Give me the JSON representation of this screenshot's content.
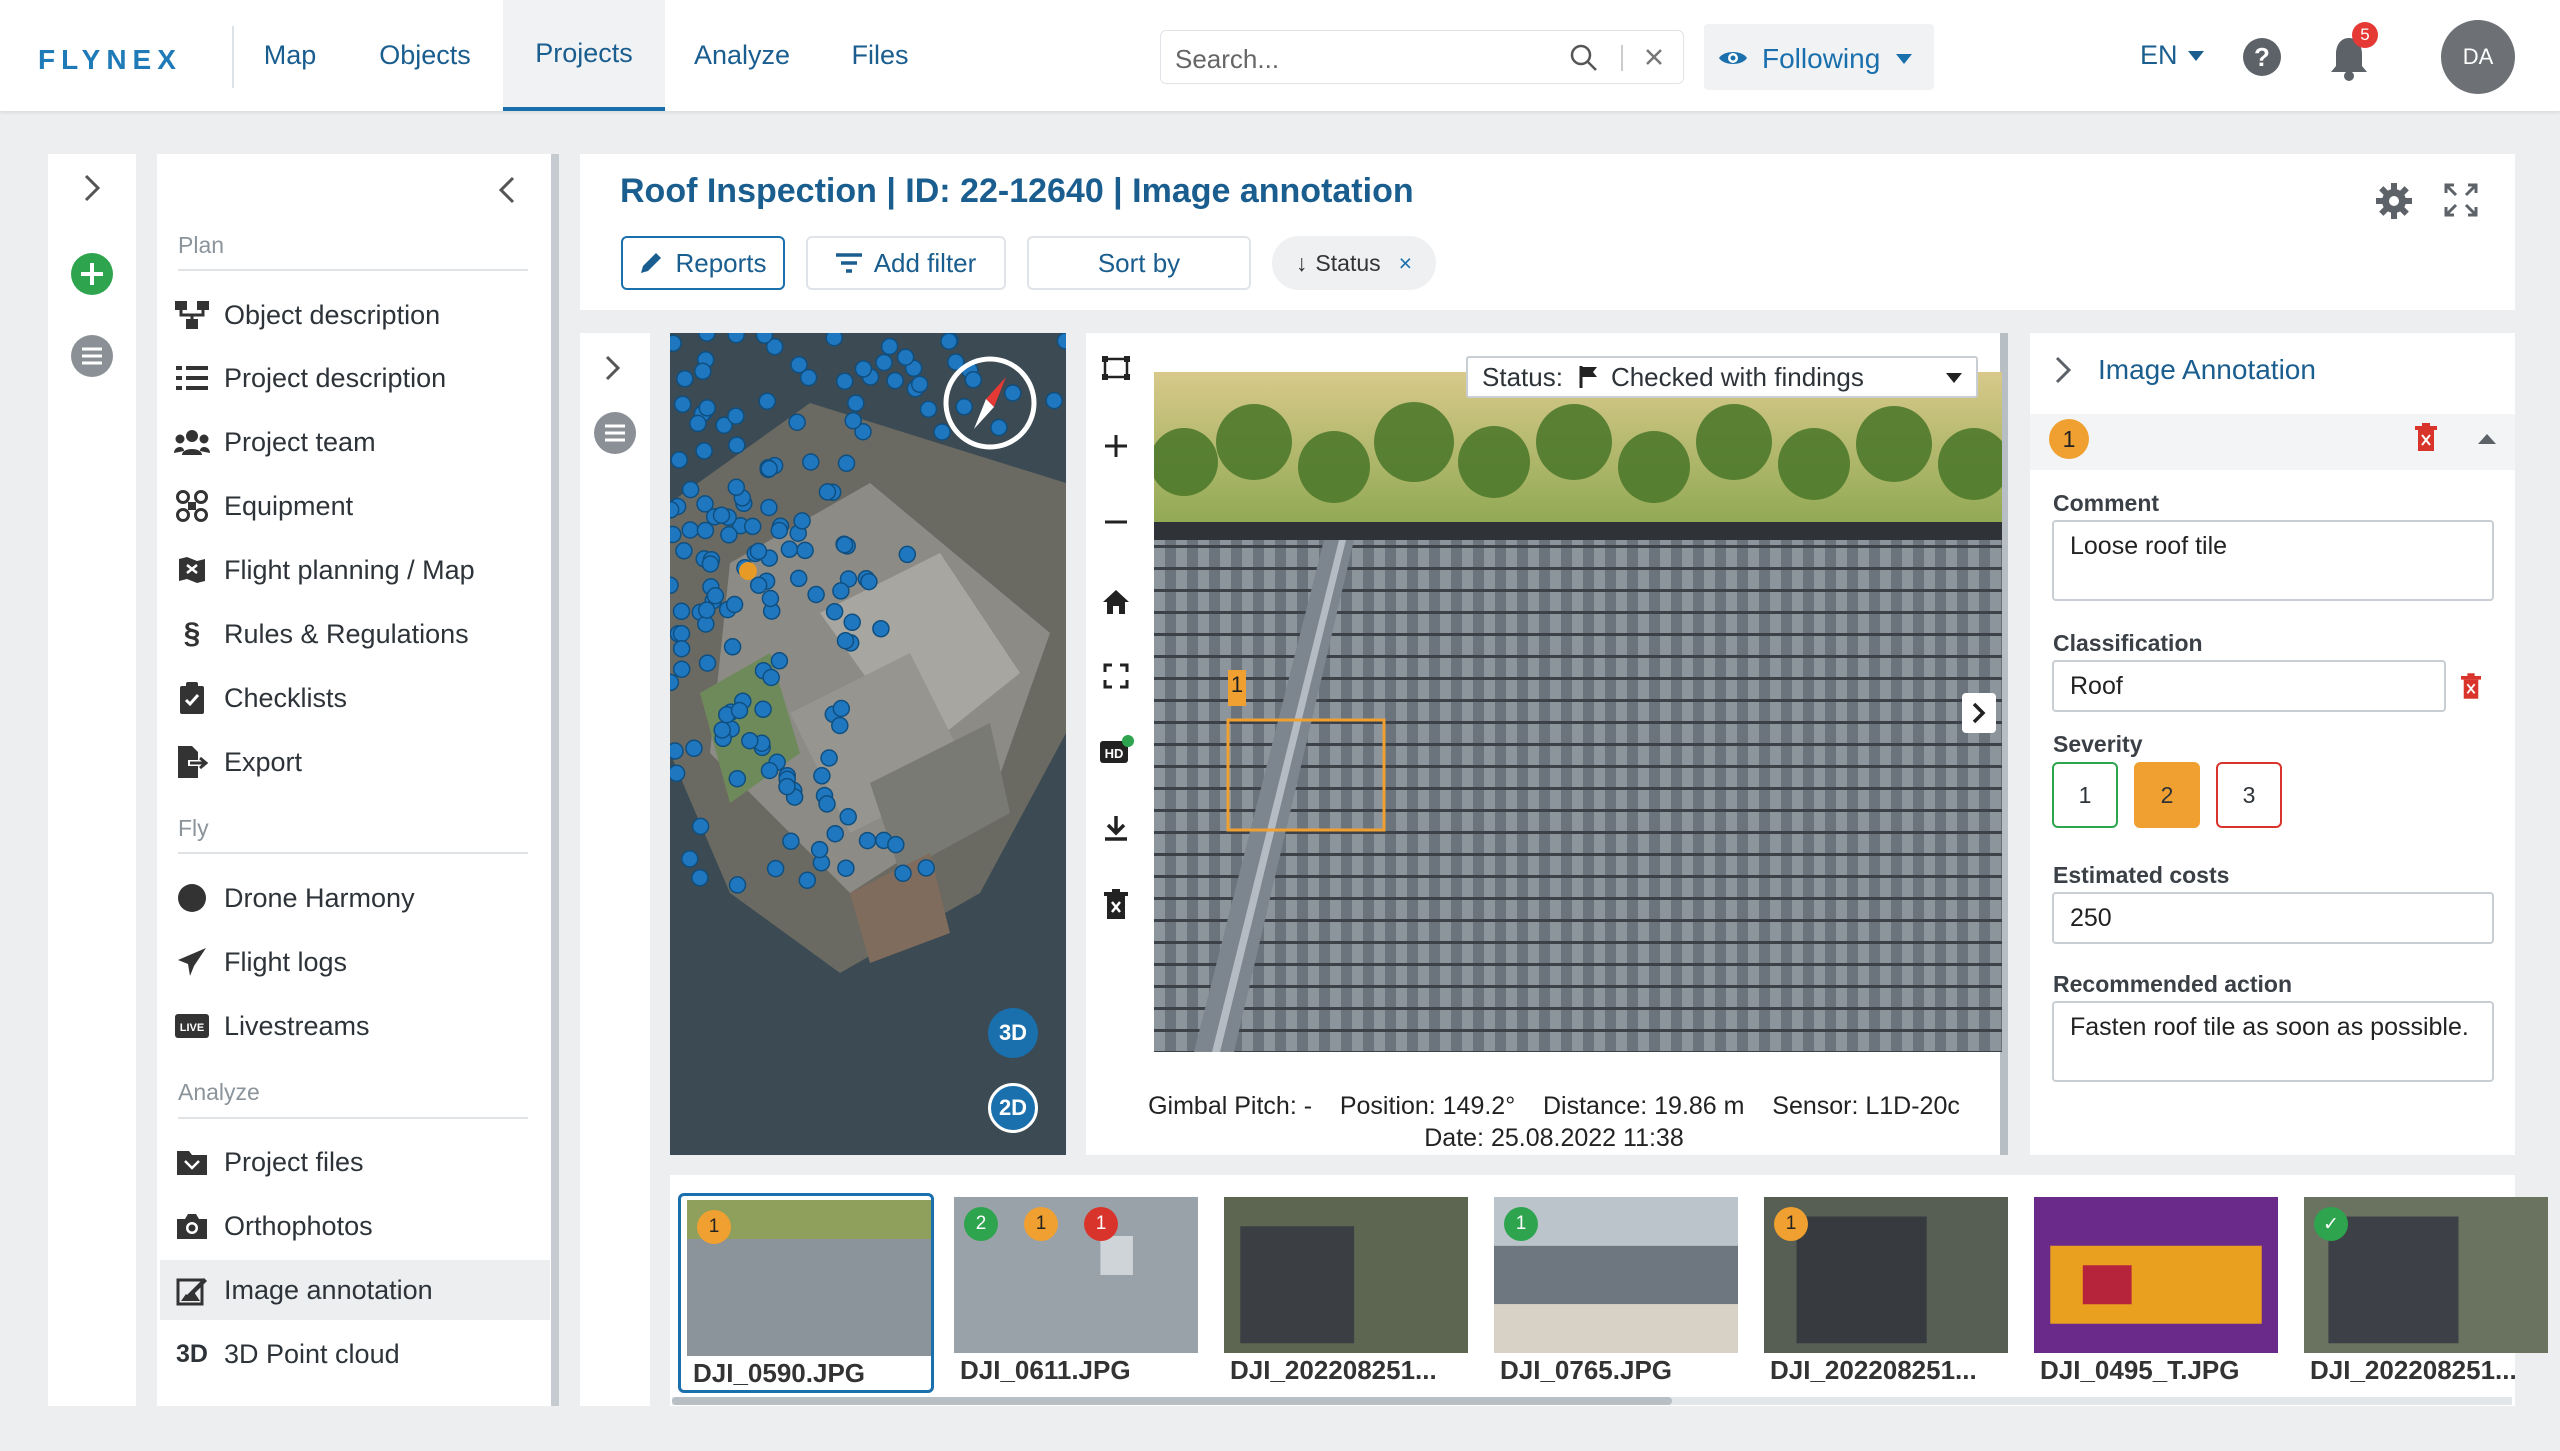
{
  "brand": {
    "logo": "FLYNEX"
  },
  "nav": {
    "items": [
      "Map",
      "Objects",
      "Projects",
      "Analyze",
      "Files"
    ],
    "active": "Projects"
  },
  "search": {
    "placeholder": "Search..."
  },
  "following": {
    "label": "Following"
  },
  "lang": {
    "label": "EN"
  },
  "notifications": {
    "count": "5"
  },
  "user": {
    "initials": "DA"
  },
  "sidebar": {
    "sections": [
      {
        "title": "Plan",
        "items": [
          {
            "label": "Object description",
            "icon": "hierarchy-icon"
          },
          {
            "label": "Project description",
            "icon": "list-icon"
          },
          {
            "label": "Project team",
            "icon": "team-icon"
          },
          {
            "label": "Equipment",
            "icon": "drone-icon"
          },
          {
            "label": "Flight planning / Map",
            "icon": "map-icon"
          },
          {
            "label": "Rules & Regulations",
            "icon": "section-icon"
          },
          {
            "label": "Checklists",
            "icon": "clipboard-icon"
          },
          {
            "label": "Export",
            "icon": "export-icon"
          }
        ]
      },
      {
        "title": "Fly",
        "items": [
          {
            "label": "Drone Harmony",
            "icon": "circle-icon"
          },
          {
            "label": "Flight logs",
            "icon": "plane-icon"
          },
          {
            "label": "Livestreams",
            "icon": "live-icon"
          }
        ]
      },
      {
        "title": "Analyze",
        "items": [
          {
            "label": "Project files",
            "icon": "folder-icon"
          },
          {
            "label": "Orthophotos",
            "icon": "camera-icon"
          },
          {
            "label": "Image annotation",
            "icon": "annotate-icon"
          },
          {
            "label": "3D Point cloud",
            "icon": "3d-text-icon",
            "text": "3D"
          }
        ]
      }
    ],
    "active": "Image annotation"
  },
  "header": {
    "title": "Roof Inspection | ID: 22-12640 | Image annotation"
  },
  "toolbar": {
    "reports": "Reports",
    "add_filter": "Add filter",
    "sort_by": "Sort by",
    "status_chip": "Status",
    "status_arrow": "↓",
    "status_close": "×"
  },
  "map": {
    "btn_3d": "3D",
    "btn_2d": "2D"
  },
  "viewer": {
    "status_label": "Status:",
    "status_value": "Checked with findings",
    "marker": "1",
    "meta1": "Gimbal Pitch: -    Position: 149.2°    Distance: 19.86 m    Sensor: L1D-20c",
    "meta2": "Date: 25.08.2022 11:38"
  },
  "annotation": {
    "panel_title": "Image Annotation",
    "number": "1",
    "comment_label": "Comment",
    "comment_value": "Loose roof tile",
    "classification_label": "Classification",
    "classification_value": "Roof",
    "severity_label": "Severity",
    "severity_options": [
      "1",
      "2",
      "3"
    ],
    "severity_selected": "2",
    "costs_label": "Estimated costs",
    "costs_value": "250",
    "action_label": "Recommended action",
    "action_value": "Fasten roof tile as soon as possible."
  },
  "thumbnails": [
    {
      "caption": "DJI_0590.JPG",
      "badges": [
        {
          "n": "1",
          "color": "#f0a030"
        }
      ]
    },
    {
      "caption": "DJI_0611.JPG",
      "badges": [
        {
          "n": "2",
          "color": "#2ea44f"
        },
        {
          "n": "1",
          "color": "#f0a030"
        },
        {
          "n": "1",
          "color": "#d9342b"
        }
      ]
    },
    {
      "caption": "DJI_202208251...",
      "badges": []
    },
    {
      "caption": "DJI_0765.JPG",
      "badges": [
        {
          "n": "1",
          "color": "#2ea44f"
        }
      ]
    },
    {
      "caption": "DJI_202208251...",
      "badges": [
        {
          "n": "1",
          "color": "#f0a030"
        }
      ]
    },
    {
      "caption": "DJI_0495_T.JPG",
      "badges": []
    },
    {
      "caption": "DJI_202208251...",
      "badges": [
        {
          "n": "✓",
          "color": "#2ea44f"
        }
      ]
    }
  ],
  "colors": {
    "accent": "#1a6fad",
    "severity_low": "#2ea44f",
    "severity_mid": "#f0a030",
    "severity_high": "#d9342b"
  }
}
